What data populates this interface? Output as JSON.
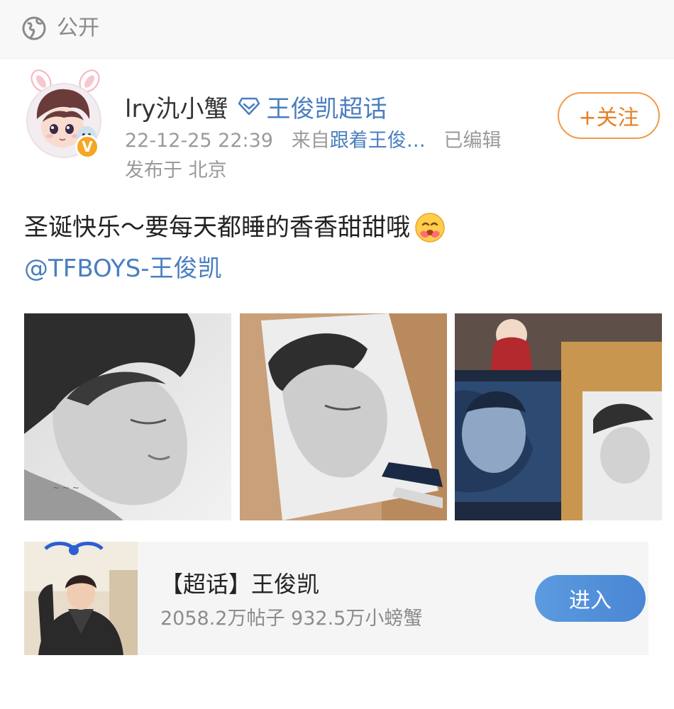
{
  "header": {
    "visibility_label": "公开",
    "visibility_icon": "globe-icon"
  },
  "post": {
    "username": "lry氿小蟹",
    "topic_icon": "diamond-icon",
    "topic_link": "王俊凯超话",
    "timestamp": "22-12-25 22:39",
    "source_prefix": "来自",
    "source": "跟着王俊…",
    "edited": "已编辑",
    "location": "发布于 北京",
    "follow_label": "+关注",
    "text": "圣诞快乐～要每天都睡的香香甜甜哦",
    "emoji": "hug-emoji",
    "mention": "@TFBOYS-王俊凯",
    "verified_badge": "V"
  },
  "topic_card": {
    "title": "【超话】王俊凯",
    "stats": "2058.2万帖子 932.5万小螃蟹",
    "enter_label": "进入"
  },
  "colors": {
    "link": "#4a7ec0",
    "follow": "#e67f25",
    "enter": "#4a86d4",
    "badge": "#f5a623"
  }
}
